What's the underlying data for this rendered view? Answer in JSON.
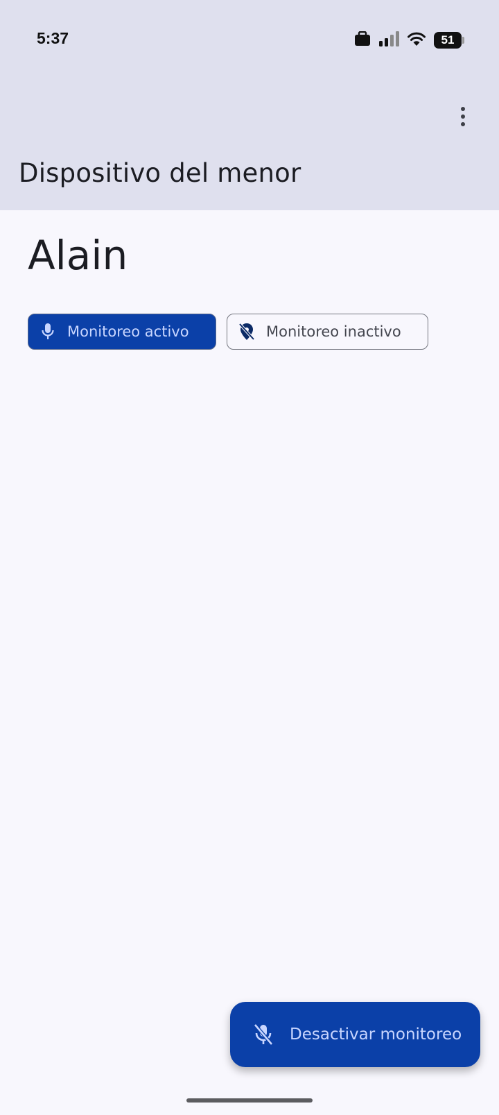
{
  "status_bar": {
    "time": "5:37",
    "battery": "51",
    "icons": [
      "briefcase-icon",
      "signal-icon",
      "wifi-icon",
      "battery-icon"
    ]
  },
  "app_bar": {
    "title": "Dispositivo del menor",
    "menu_icon": "more-vert-icon"
  },
  "child": {
    "name": "Alain"
  },
  "chips": [
    {
      "label": "Monitoreo activo",
      "icon": "mic-icon",
      "selected": true
    },
    {
      "label": "Monitoreo inactivo",
      "icon": "location-off-icon",
      "selected": false
    }
  ],
  "fab": {
    "label": "Desactivar monitoreo",
    "icon": "mic-off-icon"
  },
  "colors": {
    "app_bar_bg": "#dfe0ee",
    "background": "#f8f7fd",
    "primary": "#0b40a8",
    "on_primary": "#c9d6ff"
  }
}
